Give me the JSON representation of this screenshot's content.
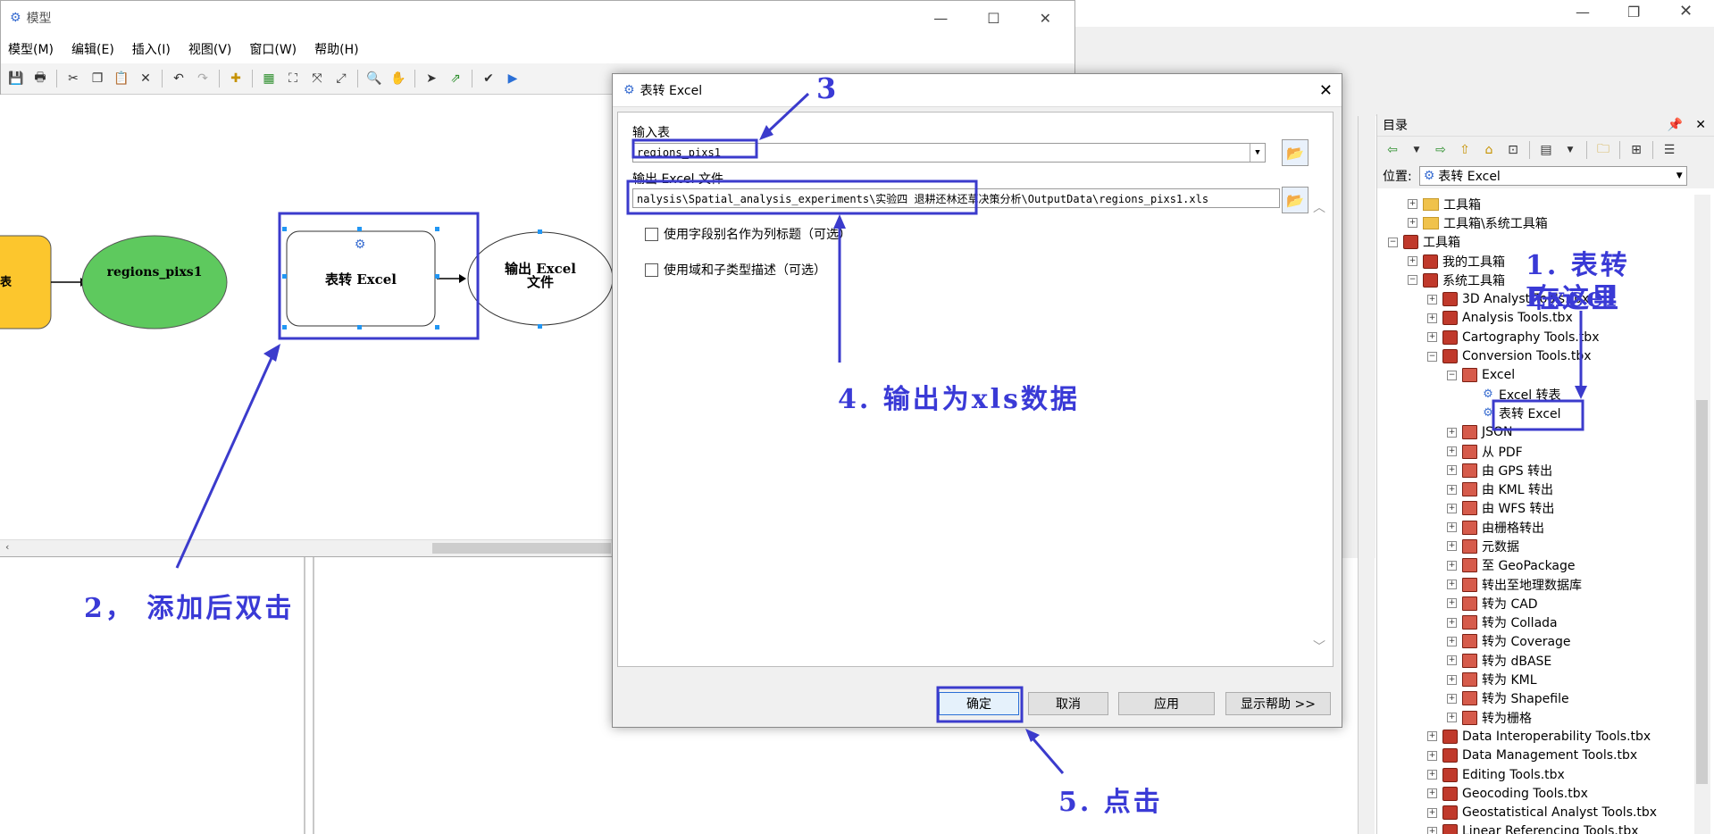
{
  "model_window": {
    "title": "模型",
    "menu": [
      "模型(M)",
      "编辑(E)",
      "插入(I)",
      "视图(V)",
      "窗口(W)",
      "帮助(H)"
    ],
    "nodes": {
      "input_partial_label": "表",
      "data_node": "regions_pixs1",
      "tool_node": "表转 Excel",
      "output_node": "输出 Excel 文件"
    }
  },
  "dialog": {
    "title": "表转 Excel",
    "input_label": "输入表",
    "input_value": "regions_pixs1",
    "output_label": "输出 Excel 文件",
    "output_value": "nalysis\\Spatial_analysis_experiments\\实验四 退耕还林还草决策分析\\OutputData\\regions_pixs1.xls",
    "checkbox1": "使用字段别名作为列标题（可选）",
    "checkbox2": "使用域和子类型描述（可选）",
    "buttons": {
      "ok": "确定",
      "cancel": "取消",
      "apply": "应用",
      "help": "显示帮助 >>"
    }
  },
  "catalog": {
    "title": "目录",
    "location_label": "位置:",
    "location_value": "表转 Excel",
    "tree": [
      {
        "level": 1,
        "pm": "+",
        "icon": "folder",
        "label": "工具箱"
      },
      {
        "level": 1,
        "pm": "+",
        "icon": "folder",
        "label": "工具箱\\系统工具箱"
      },
      {
        "level": 0,
        "pm": "-",
        "icon": "box",
        "label": "工具箱"
      },
      {
        "level": 1,
        "pm": "+",
        "icon": "box",
        "label": "我的工具箱"
      },
      {
        "level": 1,
        "pm": "-",
        "icon": "box",
        "label": "系统工具箱"
      },
      {
        "level": 2,
        "pm": "+",
        "icon": "box",
        "label": "3D Analyst Tools.tbx"
      },
      {
        "level": 2,
        "pm": "+",
        "icon": "box",
        "label": "Analysis Tools.tbx"
      },
      {
        "level": 2,
        "pm": "+",
        "icon": "box",
        "label": "Cartography Tools.tbx"
      },
      {
        "level": 2,
        "pm": "-",
        "icon": "box",
        "label": "Conversion Tools.tbx"
      },
      {
        "level": 3,
        "pm": "-",
        "icon": "set",
        "label": "Excel"
      },
      {
        "level": 4,
        "pm": "",
        "icon": "tool",
        "label": "Excel 转表"
      },
      {
        "level": 4,
        "pm": "",
        "icon": "tool",
        "label": "表转 Excel"
      },
      {
        "level": 3,
        "pm": "+",
        "icon": "set",
        "label": "JSON"
      },
      {
        "level": 3,
        "pm": "+",
        "icon": "set",
        "label": "从 PDF"
      },
      {
        "level": 3,
        "pm": "+",
        "icon": "set",
        "label": "由 GPS 转出"
      },
      {
        "level": 3,
        "pm": "+",
        "icon": "set",
        "label": "由 KML 转出"
      },
      {
        "level": 3,
        "pm": "+",
        "icon": "set",
        "label": "由 WFS 转出"
      },
      {
        "level": 3,
        "pm": "+",
        "icon": "set",
        "label": "由栅格转出"
      },
      {
        "level": 3,
        "pm": "+",
        "icon": "set",
        "label": "元数据"
      },
      {
        "level": 3,
        "pm": "+",
        "icon": "set",
        "label": "至 GeoPackage"
      },
      {
        "level": 3,
        "pm": "+",
        "icon": "set",
        "label": "转出至地理数据库"
      },
      {
        "level": 3,
        "pm": "+",
        "icon": "set",
        "label": "转为 CAD"
      },
      {
        "level": 3,
        "pm": "+",
        "icon": "set",
        "label": "转为 Collada"
      },
      {
        "level": 3,
        "pm": "+",
        "icon": "set",
        "label": "转为 Coverage"
      },
      {
        "level": 3,
        "pm": "+",
        "icon": "set",
        "label": "转为 dBASE"
      },
      {
        "level": 3,
        "pm": "+",
        "icon": "set",
        "label": "转为 KML"
      },
      {
        "level": 3,
        "pm": "+",
        "icon": "set",
        "label": "转为 Shapefile"
      },
      {
        "level": 3,
        "pm": "+",
        "icon": "set",
        "label": "转为栅格"
      },
      {
        "level": 2,
        "pm": "+",
        "icon": "box",
        "label": "Data Interoperability Tools.tbx"
      },
      {
        "level": 2,
        "pm": "+",
        "icon": "box",
        "label": "Data Management Tools.tbx"
      },
      {
        "level": 2,
        "pm": "+",
        "icon": "box",
        "label": "Editing Tools.tbx"
      },
      {
        "level": 2,
        "pm": "+",
        "icon": "box",
        "label": "Geocoding Tools.tbx"
      },
      {
        "level": 2,
        "pm": "+",
        "icon": "box",
        "label": "Geostatistical Analyst Tools.tbx"
      },
      {
        "level": 2,
        "pm": "+",
        "icon": "box",
        "label": "Linear Referencing Tools.tbx"
      }
    ]
  },
  "annotations": {
    "step1_line1": "1. 表转Excel",
    "step1_line2": "在这里",
    "step2": "2， 添加后双击",
    "step3": "3",
    "step4": "4. 输出为xls数据",
    "step5": "5. 点击"
  },
  "colors": {
    "annotation": "#3a3ad6",
    "data_node": "#5ec95e",
    "input_node": "#fcc62d"
  }
}
